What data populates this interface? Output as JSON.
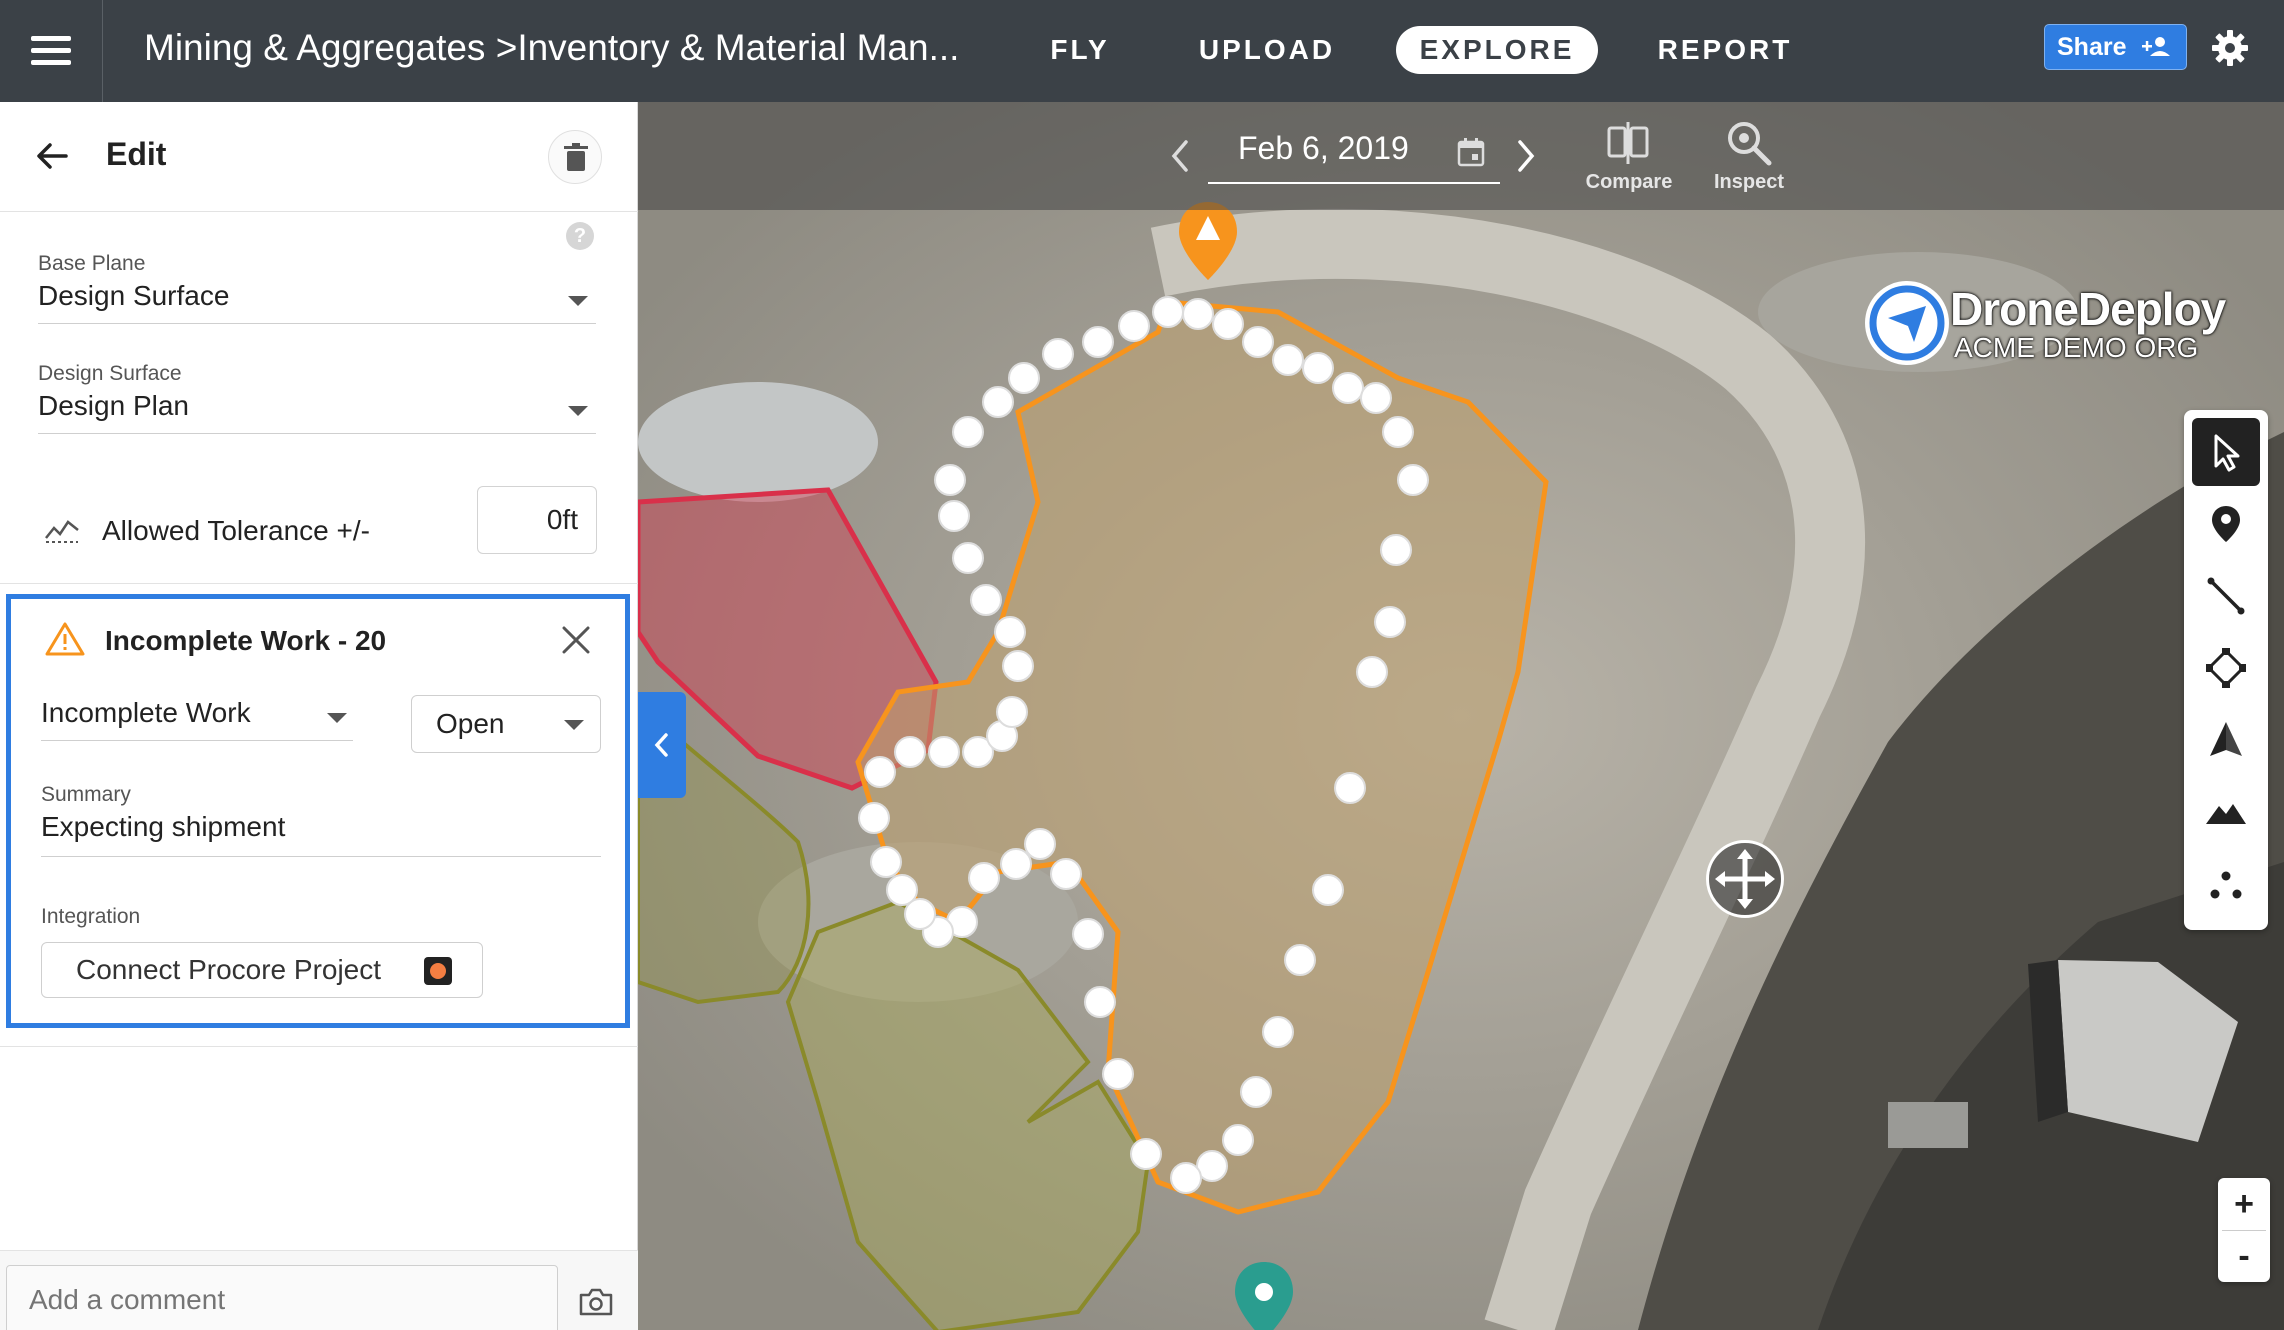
{
  "header": {
    "breadcrumb": "Mining & Aggregates >Inventory & Material Man...",
    "tabs": [
      {
        "label": "FLY",
        "active": false
      },
      {
        "label": "UPLOAD",
        "active": false
      },
      {
        "label": "EXPLORE",
        "active": true
      },
      {
        "label": "REPORT",
        "active": false
      }
    ],
    "share_label": "Share"
  },
  "panel": {
    "title": "Edit",
    "base_plane": {
      "label": "Base Plane",
      "value": "Design Surface"
    },
    "design_surface": {
      "label": "Design Surface",
      "value": "Design Plan"
    },
    "tolerance": {
      "label": "Allowed Tolerance +/-",
      "value": "0ft"
    },
    "issue": {
      "title": "Incomplete Work - 20",
      "type": "Incomplete Work",
      "status": "Open",
      "summary_label": "Summary",
      "summary_value": "Expecting shipment",
      "integration_label": "Integration",
      "integration_button": "Connect Procore Project"
    },
    "comment_placeholder": "Add a comment"
  },
  "map": {
    "date": "Feb 6, 2019",
    "tools": [
      {
        "label": "Compare",
        "icon": "compare-icon"
      },
      {
        "label": "Inspect",
        "icon": "inspect-icon"
      }
    ],
    "logo": {
      "name": "DroneDeploy",
      "org": "ACME DEMO ORG"
    },
    "toolbar_icons": [
      "pointer-icon",
      "marker-icon",
      "line-icon",
      "polygon-icon",
      "volume-icon",
      "elevation-icon",
      "points-icon"
    ],
    "zoom": {
      "in": "+",
      "out": "-"
    },
    "colors": {
      "accent": "#2f7de1",
      "issue_polygon": "#f7941d",
      "red_zone": "#d9304a",
      "olive_zone": "#8a8a2a",
      "warning_marker": "#f7941d",
      "teal_marker": "#2a9d8f"
    }
  }
}
